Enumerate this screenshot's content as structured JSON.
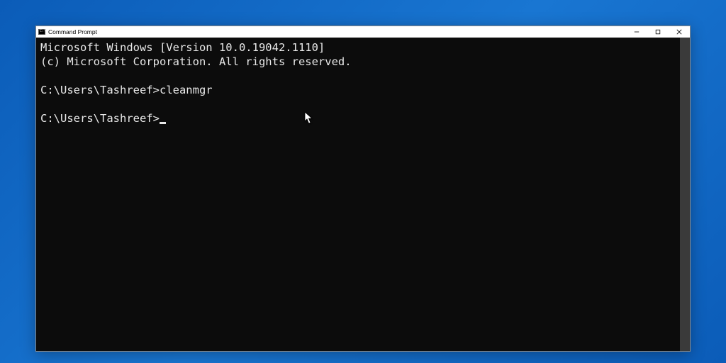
{
  "window": {
    "title": "Command Prompt",
    "icon_label": "C:\\"
  },
  "terminal": {
    "line1": "Microsoft Windows [Version 10.0.19042.1110]",
    "line2": "(c) Microsoft Corporation. All rights reserved.",
    "prompt1_path": "C:\\Users\\Tashreef>",
    "prompt1_cmd": "cleanmgr",
    "prompt2_path": "C:\\Users\\Tashreef>"
  },
  "colors": {
    "desktop_bg": "#1976d2",
    "terminal_bg": "#0c0c0c",
    "terminal_fg": "#e8e8e8"
  }
}
